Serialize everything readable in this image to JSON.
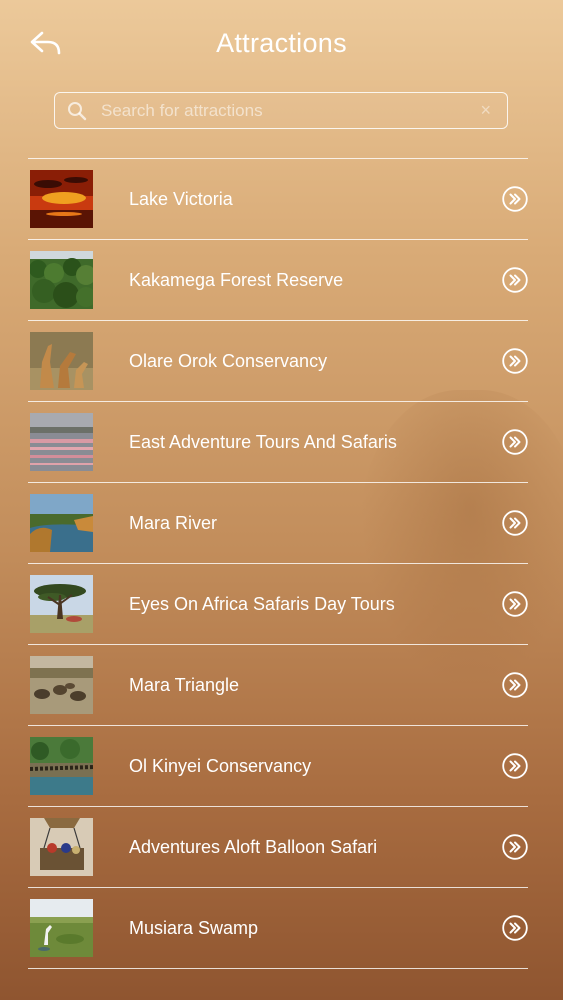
{
  "header": {
    "title": "Attractions",
    "back_icon": "back-arrow-icon"
  },
  "search": {
    "placeholder": "Search for attractions",
    "value": "",
    "icon": "search-icon",
    "clear_icon": "close-icon",
    "clear_label": "×"
  },
  "attractions": [
    {
      "name": "Lake Victoria",
      "thumb": "sunset-lake-photo"
    },
    {
      "name": "Kakamega Forest Reserve",
      "thumb": "forest-photo"
    },
    {
      "name": "Olare Orok Conservancy",
      "thumb": "giraffes-photo"
    },
    {
      "name": "East Adventure Tours And Safaris",
      "thumb": "flamingos-lake-photo"
    },
    {
      "name": "Mara River",
      "thumb": "river-photo"
    },
    {
      "name": "Eyes On Africa Safaris Day Tours",
      "thumb": "acacia-tree-photo"
    },
    {
      "name": "Mara Triangle",
      "thumb": "wildebeest-plains-photo"
    },
    {
      "name": "Ol Kinyei Conservancy",
      "thumb": "river-crossing-photo"
    },
    {
      "name": "Adventures Aloft Balloon Safari",
      "thumb": "hot-air-balloon-photo"
    },
    {
      "name": "Musiara Swamp",
      "thumb": "swamp-bird-photo"
    }
  ],
  "row_action_icon": "double-chevron-right-icon",
  "colors": {
    "text": "#ffffff",
    "background_top": "#ecc99a",
    "background_bottom": "#8f5530"
  }
}
